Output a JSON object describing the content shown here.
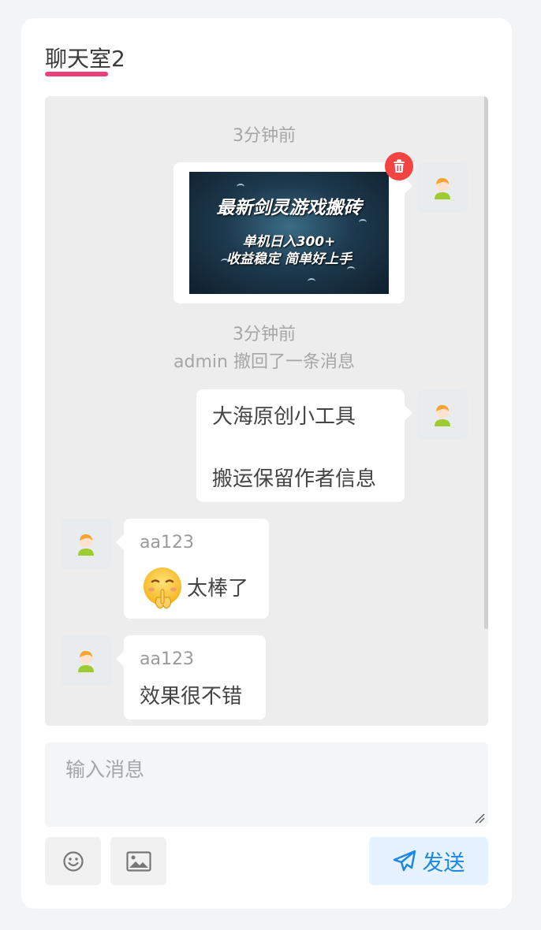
{
  "header": {
    "title": "聊天室2"
  },
  "messages": [
    {
      "time": "3分钟前",
      "side": "right",
      "type": "image",
      "image": {
        "line1": "最新剑灵游戏搬砖",
        "line2": "单机日入300+",
        "line3": "收益稳定 简单好上手"
      },
      "has_delete": true
    },
    {
      "time": "3分钟前",
      "type": "system",
      "text": "admin 撤回了一条消息"
    },
    {
      "side": "right",
      "type": "text",
      "line1": "大海原创小工具",
      "line2": "搬运保留作者信息"
    },
    {
      "side": "left",
      "type": "text",
      "sender": "aa123",
      "emoji": "shush-emoji",
      "text": "太棒了"
    },
    {
      "side": "left",
      "type": "text",
      "sender": "aa123",
      "text": "效果很不错"
    }
  ],
  "composer": {
    "placeholder": "输入消息",
    "emoji_icon": "smile-icon",
    "image_icon": "image-icon",
    "send_label": "发送",
    "send_icon": "paper-plane-icon"
  },
  "colors": {
    "accent_underline": "#ec407a",
    "delete": "#f44343",
    "send_text": "#1c88e4",
    "send_bg": "#e6f2ff",
    "chat_bg": "#ededed"
  }
}
